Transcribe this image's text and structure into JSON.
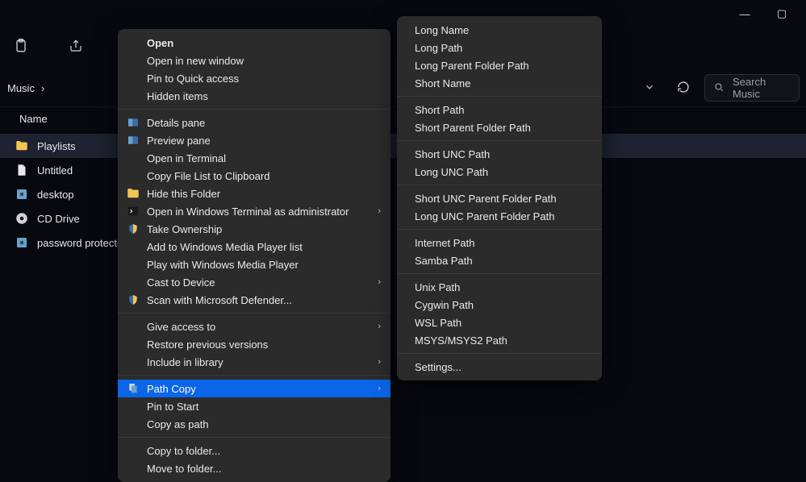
{
  "window": {
    "min": "—",
    "max": "▢"
  },
  "search": {
    "placeholder": "Search Music"
  },
  "breadcrumb": {
    "segment": "Music",
    "chevron": "›"
  },
  "column_header": "Name",
  "files": [
    {
      "label": "Playlists",
      "icon": "folder",
      "selected": true
    },
    {
      "label": "Untitled",
      "icon": "doc",
      "selected": false
    },
    {
      "label": "desktop",
      "icon": "config",
      "selected": false
    },
    {
      "label": "CD Drive",
      "icon": "cd",
      "selected": false
    },
    {
      "label": "password protected.",
      "icon": "config",
      "selected": false
    }
  ],
  "ctx": {
    "groups": [
      [
        {
          "label": "Open",
          "bold": true
        },
        {
          "label": "Open in new window"
        },
        {
          "label": "Pin to Quick access"
        },
        {
          "label": "Hidden items"
        }
      ],
      [
        {
          "label": "Details pane",
          "icon": "pane"
        },
        {
          "label": "Preview pane",
          "icon": "pane"
        },
        {
          "label": "Open in Terminal"
        },
        {
          "label": "Copy File List to Clipboard"
        },
        {
          "label": "Hide this Folder",
          "icon": "folder"
        },
        {
          "label": "Open in Windows Terminal as administrator",
          "icon": "term",
          "submenu": true
        },
        {
          "label": "Take Ownership",
          "icon": "shield"
        },
        {
          "label": "Add to Windows Media Player list"
        },
        {
          "label": "Play with Windows Media Player"
        },
        {
          "label": "Cast to Device",
          "submenu": true
        },
        {
          "label": "Scan with Microsoft Defender...",
          "icon": "shield"
        }
      ],
      [
        {
          "label": "Give access to",
          "submenu": true
        },
        {
          "label": "Restore previous versions"
        },
        {
          "label": "Include in library",
          "submenu": true
        }
      ],
      [
        {
          "label": "Path Copy",
          "icon": "copy",
          "submenu": true,
          "highlight": true
        },
        {
          "label": "Pin to Start"
        },
        {
          "label": "Copy as path"
        }
      ],
      [
        {
          "label": "Copy to folder..."
        },
        {
          "label": "Move to folder..."
        }
      ]
    ]
  },
  "sub": {
    "groups": [
      [
        {
          "label": "Long Name"
        },
        {
          "label": "Long Path"
        },
        {
          "label": "Long Parent Folder Path"
        },
        {
          "label": "Short Name"
        }
      ],
      [
        {
          "label": "Short Path"
        },
        {
          "label": "Short Parent Folder Path"
        }
      ],
      [
        {
          "label": "Short UNC Path"
        },
        {
          "label": "Long UNC Path"
        }
      ],
      [
        {
          "label": "Short UNC Parent Folder Path"
        },
        {
          "label": "Long UNC Parent Folder Path"
        }
      ],
      [
        {
          "label": "Internet Path"
        },
        {
          "label": "Samba Path"
        }
      ],
      [
        {
          "label": "Unix Path"
        },
        {
          "label": "Cygwin Path"
        },
        {
          "label": "WSL Path"
        },
        {
          "label": "MSYS/MSYS2 Path"
        }
      ],
      [
        {
          "label": "Settings..."
        }
      ]
    ]
  }
}
